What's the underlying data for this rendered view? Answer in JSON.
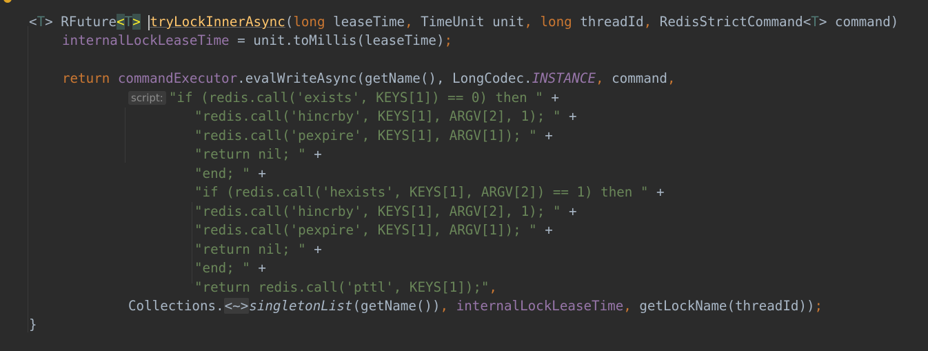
{
  "editor": {
    "line1": {
      "lt1": "<",
      "t1": "T",
      "gt1": "> ",
      "rfuture": "RFuture",
      "lt2": "<",
      "t2": "T",
      "gt2": ">",
      "space": " ",
      "method": "tryLockInnerAsync",
      "lp": "(",
      "long1": "long",
      "p1": " leaseTime",
      "c1": ", ",
      "p2type": "TimeUnit unit",
      "c2": ", ",
      "long2": "long",
      "p3": " threadId",
      "c3": ", ",
      "p4type": "RedisStrictCommand<",
      "t3": "T",
      "p4rest": "> command)"
    },
    "line2": {
      "field": "internalLockLeaseTime",
      "rest": " = unit.toMillis(leaseTime)",
      "semi": ";"
    },
    "line3": {
      "ret": "return",
      "sp": " ",
      "field": "commandExecutor",
      "call": ".evalWriteAsync(getName(), LongCodec.",
      "instance": "INSTANCE",
      "comma1": ",",
      "command": " command",
      "comma2": ","
    },
    "hint": "script:",
    "script_lines": [
      {
        "str": "\"if (redis.call('exists', KEYS[1]) == 0) then \"",
        "op": " +"
      },
      {
        "str": "\"redis.call('hincrby', KEYS[1], ARGV[2], 1); \"",
        "op": " +"
      },
      {
        "str": "\"redis.call('pexpire', KEYS[1], ARGV[1]); \"",
        "op": " +"
      },
      {
        "str": "\"return nil; \"",
        "op": " +"
      },
      {
        "str": "\"end; \"",
        "op": " +"
      },
      {
        "str": "\"if (redis.call('hexists', KEYS[1], ARGV[2]) == 1) then \"",
        "op": " +"
      },
      {
        "str": "\"redis.call('hincrby', KEYS[1], ARGV[2], 1); \"",
        "op": " +"
      },
      {
        "str": "\"redis.call('pexpire', KEYS[1], ARGV[1]); \"",
        "op": " +"
      },
      {
        "str": "\"return nil; \"",
        "op": " +"
      },
      {
        "str": "\"end; \"",
        "op": " +"
      },
      {
        "str": "\"return redis.call('pttl', KEYS[1]);\"",
        "op": ","
      }
    ],
    "last": {
      "coll": "Collections.",
      "fold": "<~>",
      "singleton": "singletonList",
      "args": "(getName())",
      "c1": ",",
      "field": " internalLockLeaseTime",
      "c2": ",",
      "rest": " getLockName(threadId))",
      "semi": ";"
    },
    "close_brace": "}"
  }
}
